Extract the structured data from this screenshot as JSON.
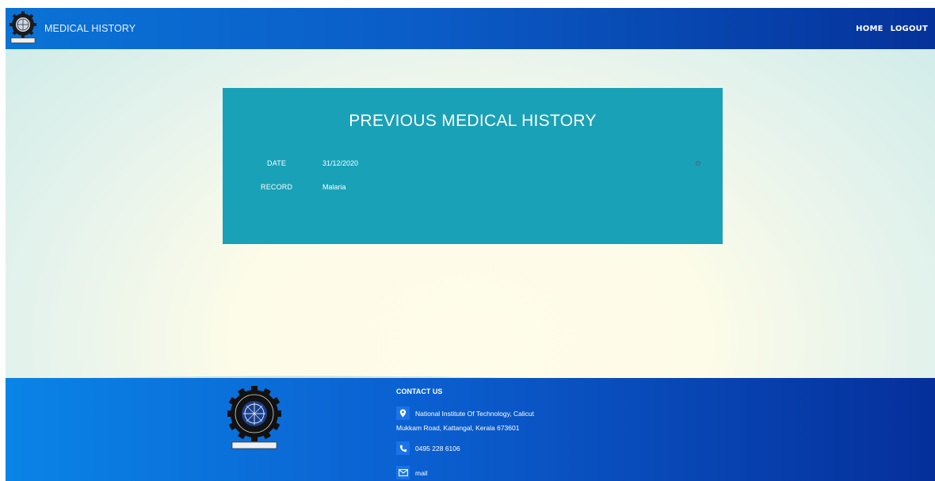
{
  "header": {
    "title": "MEDICAL HISTORY",
    "nav": [
      {
        "label": "HOME"
      },
      {
        "label": "LOGOUT"
      }
    ]
  },
  "card": {
    "title": "PREVIOUS MEDICAL HISTORY",
    "date_label": "DATE",
    "date_value": "31/12/2020",
    "record_label": "RECORD",
    "record_value": "Malaria",
    "settings_icon": "gear-icon"
  },
  "footer": {
    "contact_title": "CONTACT US",
    "address_line1": "National Institute Of Technology, Calicut",
    "address_line2": "Mukkam Road, Kattangal, Kerala 673601",
    "phone": "0495 228 6106",
    "mail": "mail",
    "icons": [
      "location-pin-icon",
      "phone-icon",
      "envelope-icon"
    ]
  },
  "colors": {
    "header": "#0b5cc7",
    "card": "#19a1b7",
    "footer": "#0b5fd0",
    "icon_box": "#1a73e8"
  }
}
